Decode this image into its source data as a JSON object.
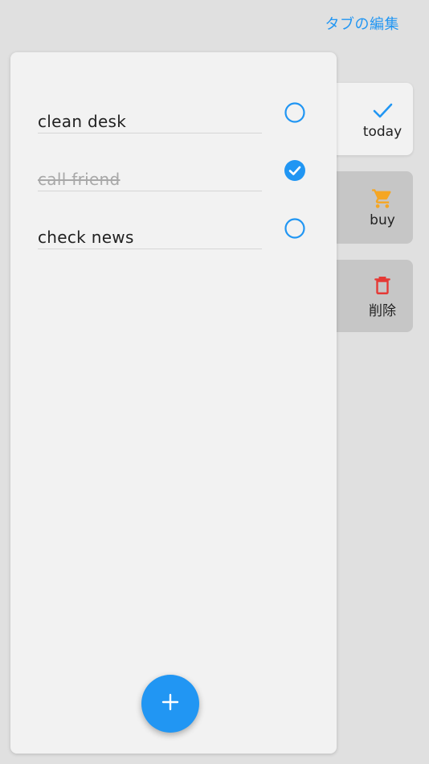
{
  "header": {
    "edit_tabs_label": "タブの編集"
  },
  "tasks": [
    {
      "text": "clean desk",
      "done": false
    },
    {
      "text": "call friend",
      "done": true
    },
    {
      "text": "check news",
      "done": false
    }
  ],
  "tabs": [
    {
      "label": "today",
      "icon": "check-icon",
      "active": true
    },
    {
      "label": "buy",
      "icon": "cart-icon",
      "active": false
    },
    {
      "label": "削除",
      "icon": "trash-icon",
      "active": false
    }
  ],
  "fab": {
    "icon": "plus-icon"
  },
  "colors": {
    "accent": "#2196f3",
    "cart": "#f5a623",
    "delete": "#e53935"
  }
}
